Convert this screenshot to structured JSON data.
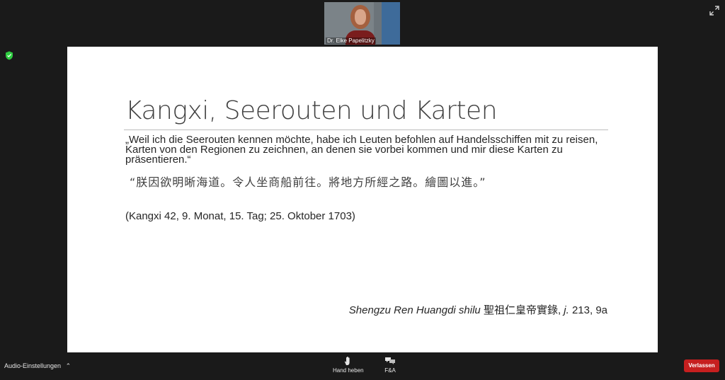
{
  "participant": {
    "name": "Dr. Elke Papelitzky"
  },
  "slide": {
    "title": "Kangxi, Seerouten und Karten",
    "quote_de": "„Weil ich die Seerouten kennen möchte, habe ich Leuten befohlen auf Handelsschiffen mit zu reisen, Karten von den Regionen zu zeichnen, an denen sie vorbei kommen und mir diese Karten zu präsentieren.“",
    "quote_zh": "“朕因欲明晰海道。令人坐商船前往。將地方所經之路。繪圖以進。”",
    "date": "(Kangxi 42, 9. Monat, 15. Tag; 25. Oktober 1703)",
    "citation": {
      "title_italic": "Shengzu Ren Huangdi shilu",
      "title_zh": "聖祖仁皇帝實錄,",
      "juan": "j.",
      "page": "213, 9a"
    }
  },
  "toolbar": {
    "audio_settings": "Audio-Einstellungen",
    "raise_hand": "Hand heben",
    "qa": "F&A",
    "leave": "Verlassen"
  },
  "colors": {
    "leave_button": "#c61f1f",
    "secure_shield": "#2ecc40"
  }
}
